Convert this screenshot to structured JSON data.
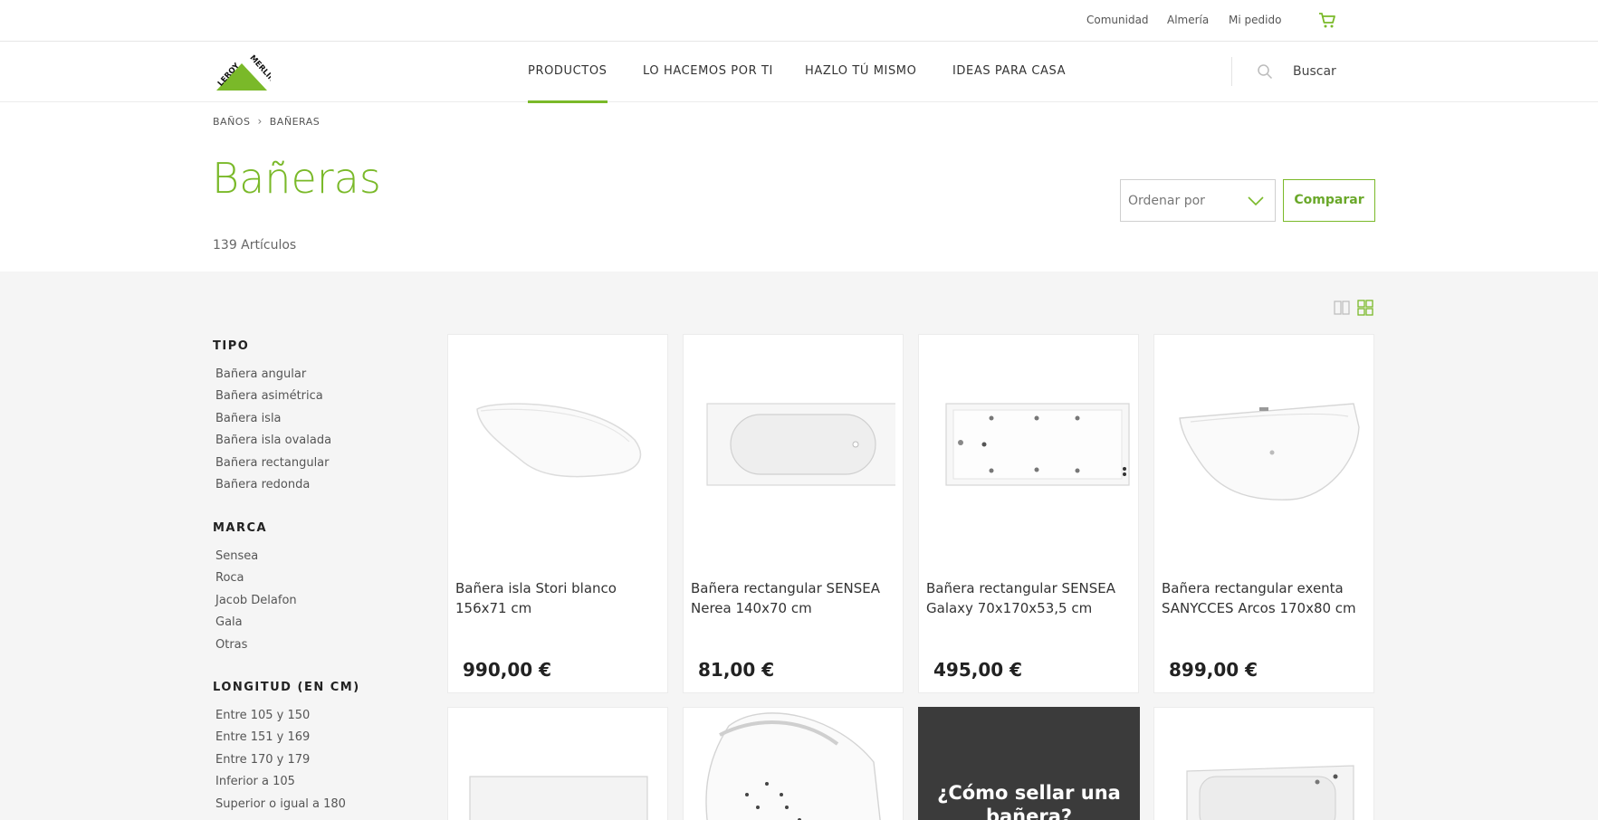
{
  "topbar": {
    "links": [
      "Comunidad",
      "Almería",
      "Mi pedido"
    ],
    "cart_icon": "cart-icon"
  },
  "brand": {
    "logo_text": "LEROY MERLIN",
    "color": "#7ab929"
  },
  "nav": {
    "items": [
      "PRODUCTOS",
      "LO HACEMOS POR TI",
      "HAZLO TÚ MISMO",
      "IDEAS PARA CASA"
    ],
    "active": "PRODUCTOS",
    "search_label": "Buscar"
  },
  "breadcrumb": [
    "BAÑOS",
    "BAÑERAS"
  ],
  "page": {
    "title": "Bañeras",
    "count": "139 Artículos",
    "sort_placeholder": "Ordenar por",
    "compare_label": "Comparar"
  },
  "filters": [
    {
      "title": "TIPO",
      "options": [
        "Bañera angular",
        "Bañera asimétrica",
        "Bañera isla",
        "Bañera isla ovalada",
        "Bañera rectangular",
        "Bañera redonda"
      ]
    },
    {
      "title": "MARCA",
      "options": [
        "Sensea",
        "Roca",
        "Jacob Delafon",
        "Gala",
        "Otras"
      ]
    },
    {
      "title": "LONGITUD (EN CM)",
      "options": [
        "Entre 105 y 150",
        "Entre 151 y 169",
        "Entre 170 y 179",
        "Inferior a 105",
        "Superior o igual a 180"
      ]
    }
  ],
  "products": [
    {
      "name": "Bañera isla Stori blanco 156x71 cm",
      "price": "990,00 €"
    },
    {
      "name": "Bañera rectangular SENSEA Nerea 140x70 cm",
      "price": "81,00 €"
    },
    {
      "name": "Bañera rectangular SENSEA Galaxy 70x170x53,5 cm",
      "price": "495,00 €"
    },
    {
      "name": "Bañera rectangular exenta SANYCCES Arcos 170x80 cm",
      "price": "899,00 €"
    }
  ],
  "promo": {
    "text_line1": "¿Cómo sellar una",
    "text_line2": "bañera?"
  }
}
